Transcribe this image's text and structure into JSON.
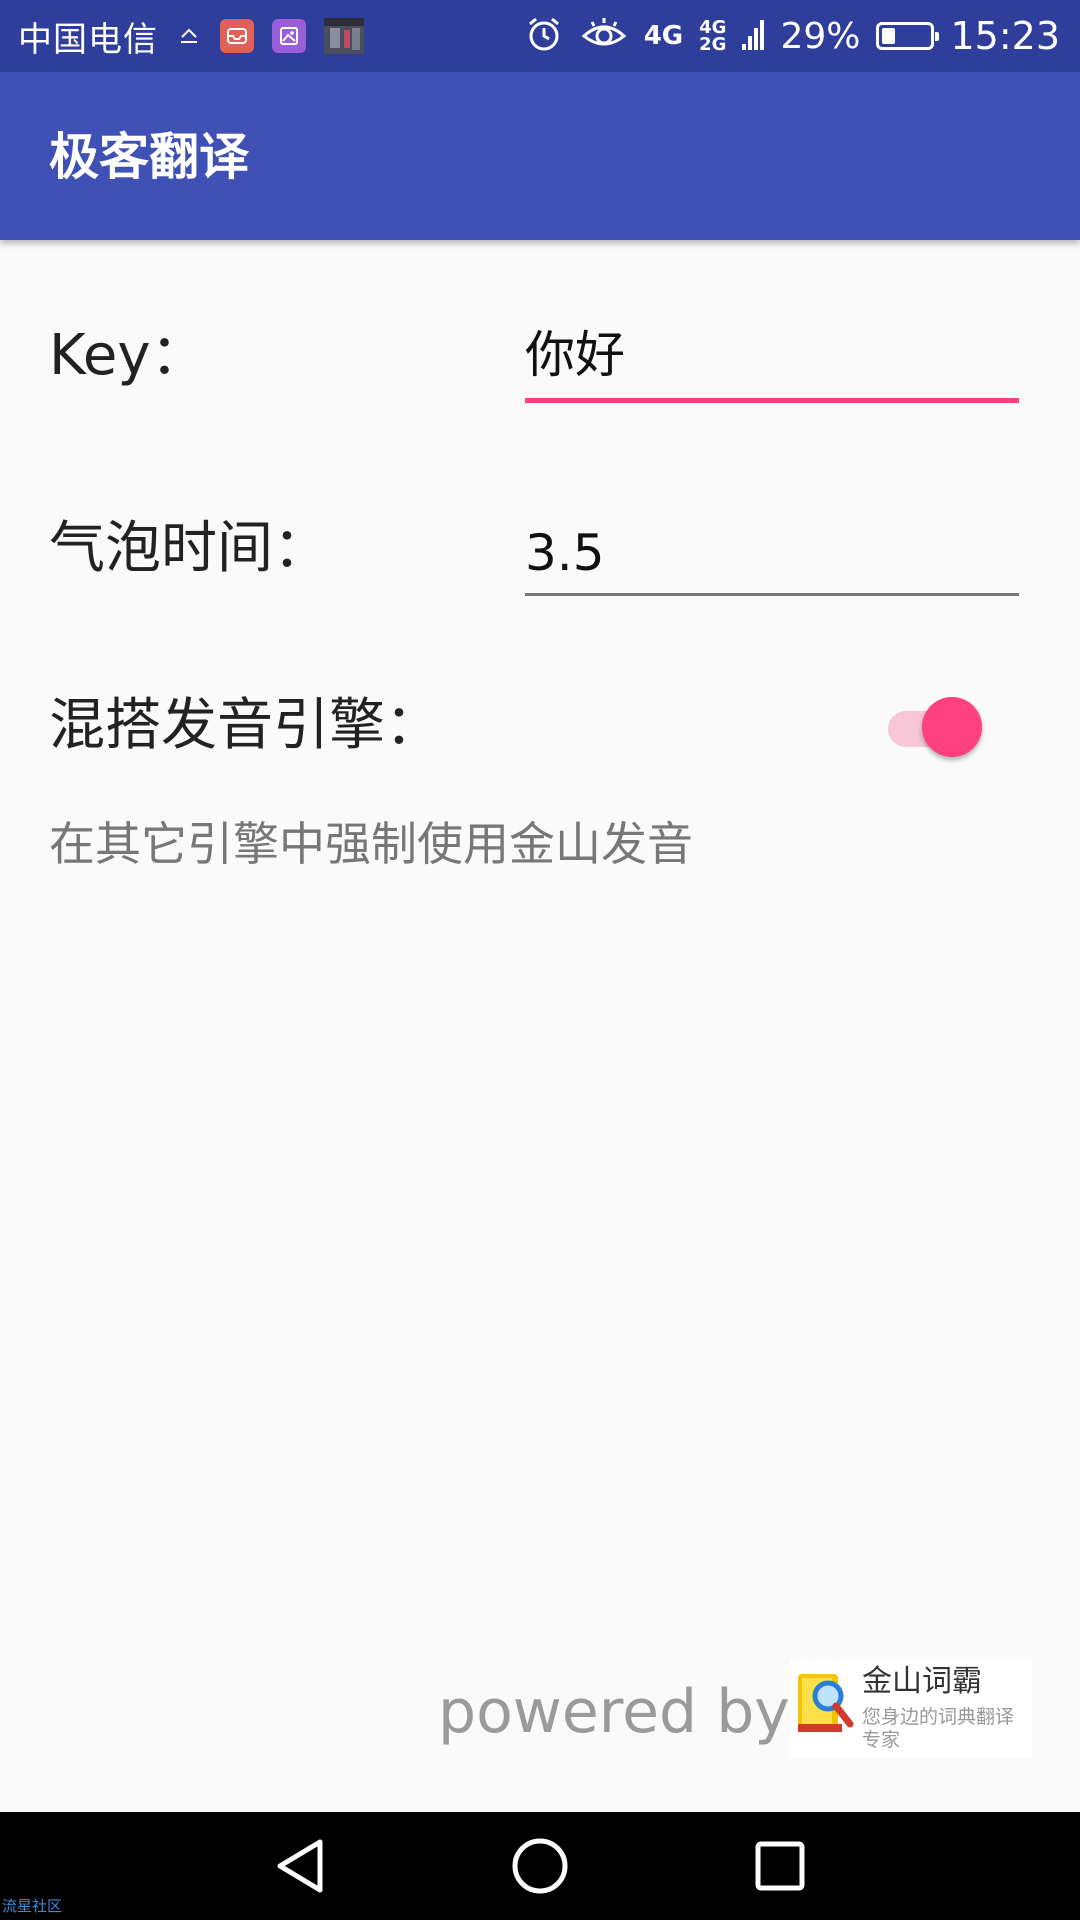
{
  "status_bar": {
    "carrier": "中国电信",
    "network_primary": "4G",
    "network_secondary_top": "4G",
    "network_secondary_bottom": "2G",
    "battery_percent": "29%",
    "battery_level": 0.29,
    "time": "15:23",
    "icons": [
      "upload-icon",
      "mail-app-icon",
      "gallery-app-icon",
      "photo-thumbnail-icon",
      "alarm-icon",
      "eye-icon",
      "signal-icon",
      "battery-icon"
    ]
  },
  "app_bar": {
    "title": "极客翻译"
  },
  "form": {
    "key_label": "Key：",
    "key_value": "你好",
    "bubble_label": "气泡时间：",
    "bubble_value": "3.5",
    "mix_label": "混搭发音引擎：",
    "mix_enabled": true,
    "mix_hint": "在其它引擎中强制使用金山发音"
  },
  "footer": {
    "powered_by": "powered by",
    "brand_name": "金山词霸",
    "brand_tagline": "您身边的词典翻译专家"
  },
  "nav_bar": {
    "buttons": [
      "back-icon",
      "home-icon",
      "recent-apps-icon"
    ]
  },
  "watermark": "流星社区",
  "colors": {
    "status_bar": "#2f3e9b",
    "app_bar": "#3f51b5",
    "accent": "#ff4081",
    "background": "#fafafa"
  }
}
